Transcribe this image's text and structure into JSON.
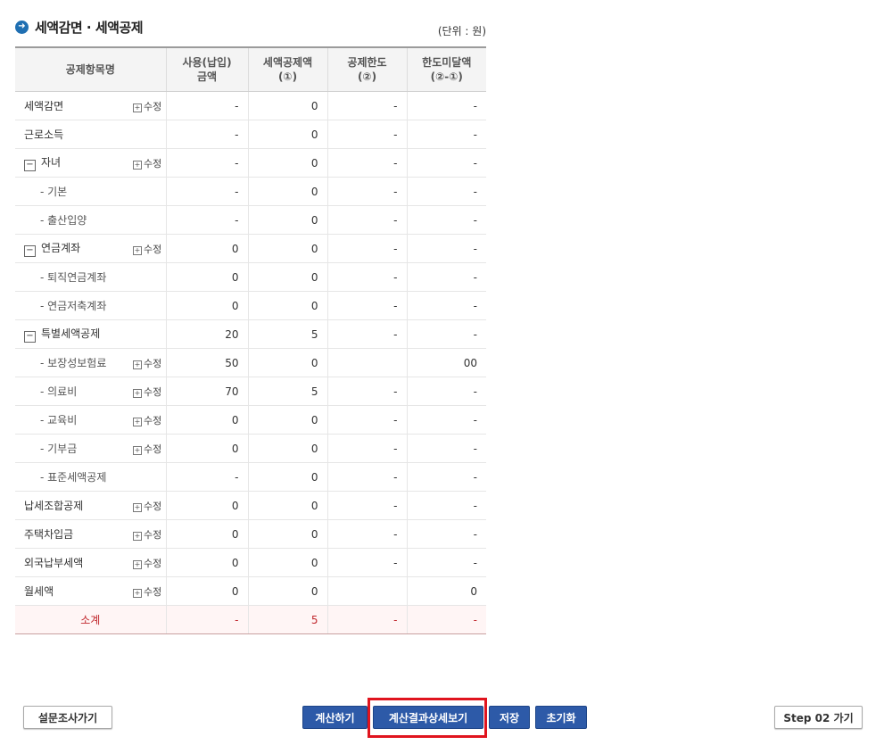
{
  "section": {
    "icon": "arrow-right-circle-icon",
    "title": "세액감면 · 세액공제",
    "unit": "(단위 : 원)"
  },
  "table": {
    "headers": {
      "item": "공제항목명",
      "amount": "사용(납입)\n금액",
      "credit": "세액공제액\n(①)",
      "limit": "공제한도\n(②)",
      "under": "한도미달액\n(②-①)"
    },
    "rows": [
      {
        "name": "세액감면",
        "toggle": "",
        "edit": "수정",
        "amount": "-",
        "credit": "0",
        "limit": "-",
        "under": "-"
      },
      {
        "name": "근로소득",
        "toggle": "",
        "edit": "",
        "amount": "-",
        "credit": "0",
        "limit": "-",
        "under": "-"
      },
      {
        "name": "자녀",
        "toggle": "−",
        "edit": "수정",
        "amount": "-",
        "credit": "0",
        "limit": "-",
        "under": "-"
      },
      {
        "name": "- 기본",
        "toggle": "",
        "edit": "",
        "amount": "-",
        "credit": "0",
        "limit": "-",
        "under": "-",
        "sub": true
      },
      {
        "name": "- 출산입양",
        "toggle": "",
        "edit": "",
        "amount": "-",
        "credit": "0",
        "limit": "-",
        "under": "-",
        "sub": true
      },
      {
        "name": "연금계좌",
        "toggle": "−",
        "edit": "수정",
        "amount": "0",
        "credit": "0",
        "limit": "-",
        "under": "-"
      },
      {
        "name": "- 퇴직연금계좌",
        "toggle": "",
        "edit": "",
        "amount": "0",
        "credit": "0",
        "limit": "-",
        "under": "-",
        "sub": true
      },
      {
        "name": "- 연금저축계좌",
        "toggle": "",
        "edit": "",
        "amount": "0",
        "credit": "0",
        "limit": "-",
        "under": "-",
        "sub": true
      },
      {
        "name": "특별세액공제",
        "toggle": "−",
        "edit": "",
        "amount": "20",
        "credit": "5",
        "limit": "-",
        "under": "-"
      },
      {
        "name": "- 보장성보험료",
        "toggle": "",
        "edit": "수정",
        "amount": "50",
        "credit": "0",
        "limit": "",
        "under": "00",
        "sub": true
      },
      {
        "name": "- 의료비",
        "toggle": "",
        "edit": "수정",
        "amount": "70",
        "credit": "5",
        "limit": "-",
        "under": "-",
        "sub": true
      },
      {
        "name": "- 교육비",
        "toggle": "",
        "edit": "수정",
        "amount": "0",
        "credit": "0",
        "limit": "-",
        "under": "-",
        "sub": true
      },
      {
        "name": "- 기부금",
        "toggle": "",
        "edit": "수정",
        "amount": "0",
        "credit": "0",
        "limit": "-",
        "under": "-",
        "sub": true
      },
      {
        "name": "- 표준세액공제",
        "toggle": "",
        "edit": "",
        "amount": "-",
        "credit": "0",
        "limit": "-",
        "under": "-",
        "sub": true
      },
      {
        "name": "납세조합공제",
        "toggle": "",
        "edit": "수정",
        "amount": "0",
        "credit": "0",
        "limit": "-",
        "under": "-"
      },
      {
        "name": "주택차입금",
        "toggle": "",
        "edit": "수정",
        "amount": "0",
        "credit": "0",
        "limit": "-",
        "under": "-"
      },
      {
        "name": "외국납부세액",
        "toggle": "",
        "edit": "수정",
        "amount": "0",
        "credit": "0",
        "limit": "-",
        "under": "-"
      },
      {
        "name": "월세액",
        "toggle": "",
        "edit": "수정",
        "amount": "0",
        "credit": "0",
        "limit": "",
        "under": "0"
      }
    ],
    "subtotal": {
      "name": "소계",
      "amount": "-",
      "credit": "5",
      "limit": "-",
      "under": "-"
    }
  },
  "buttons": {
    "survey": "설문조사가기",
    "calculate": "계산하기",
    "detail": "계산결과상세보기",
    "save": "저장",
    "reset": "초기화",
    "step2": "Step 02 가기"
  },
  "colors": {
    "highlight": "#e0141e",
    "accent": "#2d5aa8",
    "subtotal": "#c1272d"
  }
}
